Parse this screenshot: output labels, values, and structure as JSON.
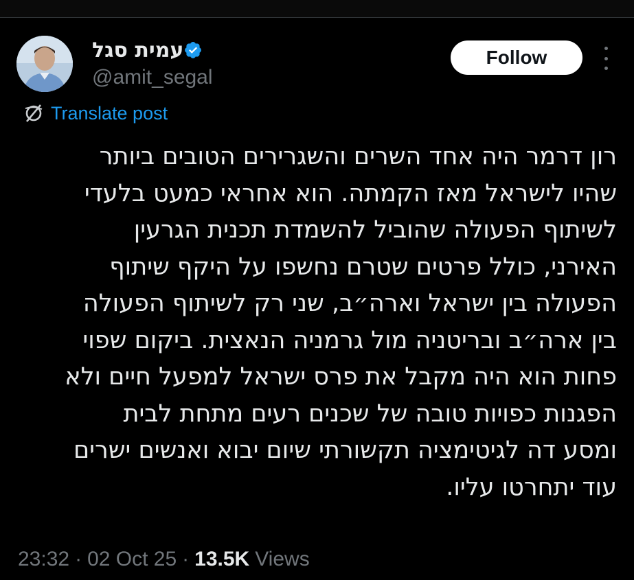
{
  "author": {
    "display_name": "עמית סגל",
    "handle": "@amit_segal",
    "verified": true,
    "verified_color": "#1d9bf0"
  },
  "actions": {
    "follow_label": "Follow",
    "more_icon": "more-vertical-icon"
  },
  "translate": {
    "label": "Translate post",
    "icon": "translate-globe-icon",
    "color": "#1d9bf0"
  },
  "post": {
    "lines": [
      "רון דרמר היה אחד השרים והשגרירים הטובים ביותר",
      "שהיו לישראל מאז הקמתה. הוא אחראי כמעט בלעדי",
      "לשיתוף הפעולה שהוביל להשמדת תכנית הגרעין",
      "האירני, כולל פרטים שטרם נחשפו על היקף שיתוף",
      "הפעולה בין ישראל וארה״ב, שני רק לשיתוף הפעולה",
      "בין ארה״ב ובריטניה מול גרמניה הנאצית. ביקום שפוי",
      "פחות הוא היה מקבל את פרס ישראל למפעל חיים ולא",
      "הפגנות כפויות טובה של שכנים רעים מתחת לבית",
      "ומסע דה לגיטימציה תקשורתי שיום יבוא ואנשים ישרים",
      "עוד יתחרטו עליו."
    ]
  },
  "meta": {
    "time": "23:32",
    "separator": "·",
    "date": "02 Oct 25",
    "views_count": "13.5K",
    "views_label": "Views"
  },
  "colors": {
    "background": "#000000",
    "text": "#e7e9ea",
    "secondary": "#71767b",
    "accent": "#1d9bf0"
  }
}
